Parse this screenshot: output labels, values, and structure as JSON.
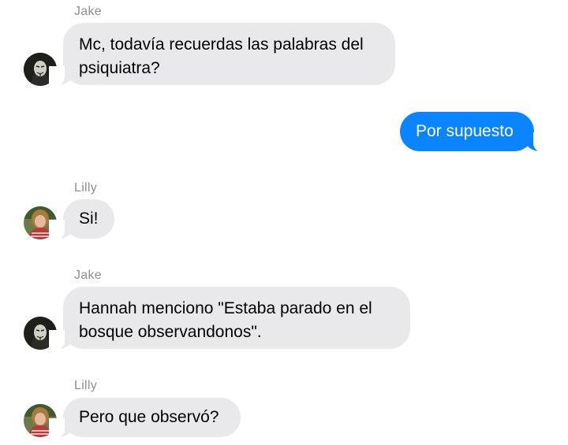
{
  "messages": [
    {
      "sender": "Jake",
      "text": "Mc, todavía recuerdas las palabras del psiquiatra?",
      "avatar": "masked-figure-avatar"
    },
    {
      "text": "Por supuesto",
      "direction": "outgoing"
    },
    {
      "sender": "Lilly",
      "text": "Si!",
      "avatar": "girl-photo-avatar"
    },
    {
      "sender": "Jake",
      "text": "Hannah menciono \"Estaba parado en el bosque observandonos\".",
      "avatar": "masked-figure-avatar"
    },
    {
      "sender": "Lilly",
      "text": "Pero que observó?",
      "avatar": "girl-photo-avatar"
    }
  ],
  "colors": {
    "incoming_bubble": "#e9e9eb",
    "outgoing_bubble": "#0a84ff",
    "sender_name": "#8e8e93"
  }
}
